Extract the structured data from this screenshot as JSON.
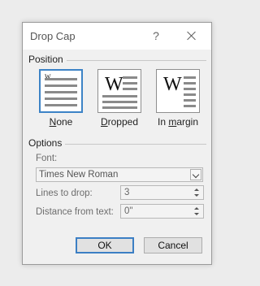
{
  "dialog": {
    "title": "Drop Cap",
    "help_label": "?"
  },
  "position": {
    "group_label": "Position",
    "options": [
      {
        "label": "None",
        "mnemonic": "N",
        "selected": true
      },
      {
        "label": "Dropped",
        "mnemonic": "D",
        "selected": false
      },
      {
        "label": "In margin",
        "mnemonic": "m",
        "selected": false
      }
    ],
    "icon_letter": "W"
  },
  "options": {
    "group_label": "Options",
    "font_label": "Font:",
    "font_value": "Times New Roman",
    "lines_label": "Lines to drop:",
    "lines_value": "3",
    "distance_label": "Distance from text:",
    "distance_value": "0\""
  },
  "buttons": {
    "ok_label": "OK",
    "cancel_label": "Cancel"
  },
  "colors": {
    "accent": "#3c83c6"
  }
}
